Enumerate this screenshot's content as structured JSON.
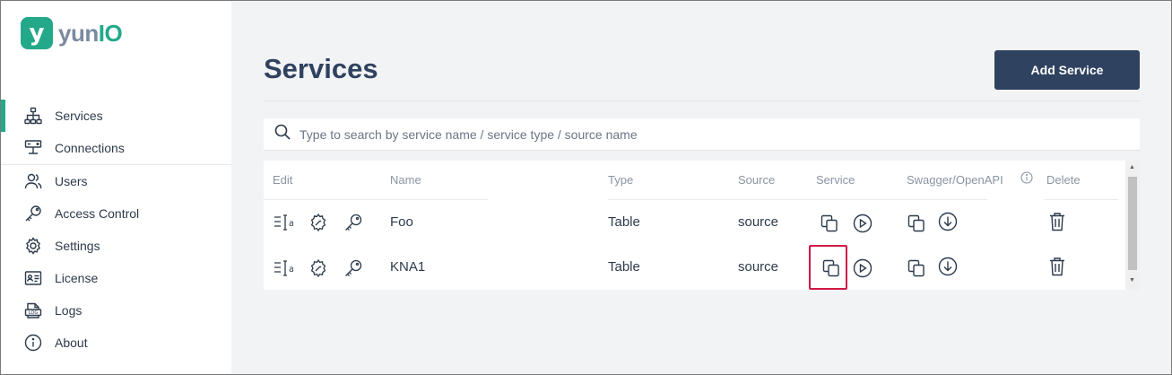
{
  "app": {
    "logo_letter": "y",
    "logo_text_a": "yun",
    "logo_text_b": "IO",
    "accent": "#23a98a",
    "primary": "#2f4260",
    "highlight": "#d21a45"
  },
  "sidebar": {
    "items": [
      {
        "label": "Services",
        "icon": "sitemap-icon",
        "active": true
      },
      {
        "label": "Connections",
        "icon": "server-icon"
      },
      {
        "label": "Users",
        "icon": "users-icon"
      },
      {
        "label": "Access Control",
        "icon": "key-icon"
      },
      {
        "label": "Settings",
        "icon": "gear-icon"
      },
      {
        "label": "License",
        "icon": "id-card-icon"
      },
      {
        "label": "Logs",
        "icon": "log-icon"
      },
      {
        "label": "About",
        "icon": "info-icon"
      }
    ]
  },
  "header": {
    "title": "Services",
    "add_button": "Add Service"
  },
  "search": {
    "placeholder": "Type to search by service name / service type / source name"
  },
  "table": {
    "columns": {
      "edit": "Edit",
      "name": "Name",
      "type": "Type",
      "source": "Source",
      "service": "Service",
      "swagger": "Swagger/OpenAPI",
      "delete": "Delete"
    },
    "rows": [
      {
        "name": "Foo",
        "type": "Table",
        "source": "source"
      },
      {
        "name": "KNA1",
        "type": "Table",
        "source": "source"
      }
    ]
  }
}
